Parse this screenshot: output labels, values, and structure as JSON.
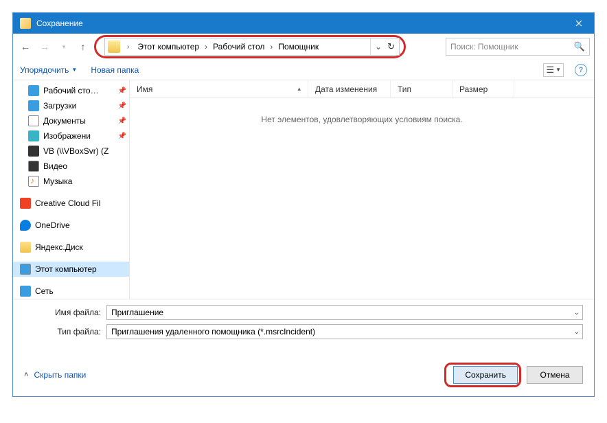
{
  "titlebar": {
    "title": "Сохранение"
  },
  "breadcrumb": {
    "segments": [
      "Этот компьютер",
      "Рабочий стол",
      "Помощник"
    ]
  },
  "search": {
    "placeholder": "Поиск: Помощник"
  },
  "toolbar": {
    "organize": "Упорядочить",
    "newfolder": "Новая папка"
  },
  "tree": {
    "items": [
      {
        "label": "Рабочий сто…",
        "icon": "i-desktop",
        "pin": true
      },
      {
        "label": "Загрузки",
        "icon": "i-dl",
        "pin": true
      },
      {
        "label": "Документы",
        "icon": "i-docs",
        "pin": true
      },
      {
        "label": "Изображени",
        "icon": "i-img",
        "pin": true
      },
      {
        "label": "VB (\\\\VBoxSvr) (Z",
        "icon": "i-vb",
        "pin": false
      },
      {
        "label": "Видео",
        "icon": "i-video",
        "pin": false
      },
      {
        "label": "Музыка",
        "icon": "i-music",
        "pin": false
      }
    ],
    "group2": [
      {
        "label": "Creative Cloud Fil",
        "icon": "i-cc"
      },
      {
        "label": "OneDrive",
        "icon": "i-onedrive"
      },
      {
        "label": "Яндекс.Диск",
        "icon": "i-folder"
      }
    ],
    "group3": [
      {
        "label": "Этот компьютер",
        "icon": "i-pc",
        "selected": true
      },
      {
        "label": "Сеть",
        "icon": "i-net"
      }
    ]
  },
  "columns": {
    "name": "Имя",
    "date": "Дата изменения",
    "type": "Тип",
    "size": "Размер"
  },
  "list": {
    "empty": "Нет элементов, удовлетворяющих условиям поиска."
  },
  "fields": {
    "filename_label": "Имя файла:",
    "filename_value": "Приглашение",
    "filetype_label": "Тип файла:",
    "filetype_value": "Приглашения удаленного помощника (*.msrcIncident)"
  },
  "actions": {
    "hide_folders": "Скрыть папки",
    "save": "Сохранить",
    "cancel": "Отмена"
  }
}
